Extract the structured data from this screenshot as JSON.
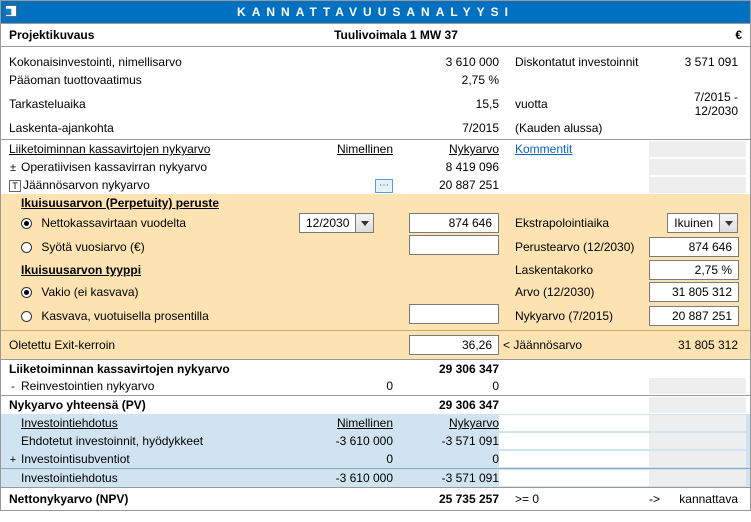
{
  "title": "KANNATTAVUUSANALYYSI",
  "currency": "€",
  "project": {
    "label": "Projektikuvaus",
    "name": "Tuulivoimala 1 MW 37"
  },
  "top": {
    "invest_label": "Kokonaisinvestointi, nimellisarvo",
    "invest_val": "3 610 000",
    "return_label": "Pääoman tuottovaatimus",
    "return_val": "2,75 %",
    "period_label": "Tarkasteluaika",
    "period_val": "15,5",
    "calc_label": "Laskenta-ajankohta",
    "calc_val": "7/2015",
    "disc_label": "Diskontatut investoinnit",
    "disc_val": "3 571 091",
    "years_label": "vuotta",
    "years_range": "7/2015 - 12/2030",
    "kauden": "(Kauden alussa)"
  },
  "cf": {
    "row1_label": "Liiketoiminnan kassavirtojen nykyarvo",
    "h_nominal": "Nimellinen",
    "h_pv": "Nykyarvo",
    "kommentit": "Kommentit",
    "row2_label": "Operatiivisen kassavirran nykyarvo",
    "row2_val": "8 419 096",
    "row3_label": "Jäännösarvon nykyarvo",
    "row3_val": "20 887 251"
  },
  "perp": {
    "basis_title": "Ikuisuusarvon (Perpetuity) peruste",
    "opt_netcash": "Nettokassavirtaan vuodelta",
    "opt_enter": "Syötä vuosiarvo (€)",
    "combo_year": "12/2030",
    "netcash_val": "874 646",
    "type_title": "Ikuisuusarvon tyyppi",
    "opt_fixed": "Vakio (ei kasvava)",
    "opt_growing": "Kasvava, vuotuisella prosentilla",
    "r_extrap_label": "Ekstrapolointiaika",
    "r_extrap_val": "Ikuinen",
    "r_base_label": "Perustearvo (12/2030)",
    "r_base_val": "874 646",
    "r_rate_label": "Laskentakorko",
    "r_rate_val": "2,75 %",
    "r_value_label": "Arvo (12/2030)",
    "r_value_val": "31 805 312",
    "r_pv_label": "Nykyarvo (7/2015)",
    "r_pv_val": "20 887 251"
  },
  "exit": {
    "label": "Oletettu Exit-kerroin",
    "val": "36,26",
    "lt": "<",
    "residual_label": "Jäännösarvo",
    "residual_val": "31 805 312"
  },
  "totals": {
    "biz_pv_label": "Liiketoiminnan kassavirtojen nykyarvo",
    "biz_pv_val": "29 306 347",
    "reinvest_label": "Reinvestointien nykyarvo",
    "reinvest_mid": "0",
    "reinvest_val": "0",
    "pv_total_label": "Nykyarvo yhteensä (PV)",
    "pv_total_val": "29 306 347"
  },
  "invest": {
    "title": "Investointiehdotus",
    "h_nominal": "Nimellinen",
    "h_pv": "Nykyarvo",
    "goods_label": "Ehdotetut investoinnit, hyödykkeet",
    "goods_nom": "-3 610 000",
    "goods_pv": "-3 571 091",
    "subs_label": "Investointisubventiot",
    "subs_nom": "0",
    "subs_pv": "0",
    "total_label": "Investointiehdotus",
    "total_nom": "-3 610 000",
    "total_pv": "-3 571 091"
  },
  "npv": {
    "label": "Nettonykyarvo (NPV)",
    "val": "25 735 257",
    "cmp": ">= 0",
    "arrow": "->",
    "verdict": "kannattava"
  }
}
